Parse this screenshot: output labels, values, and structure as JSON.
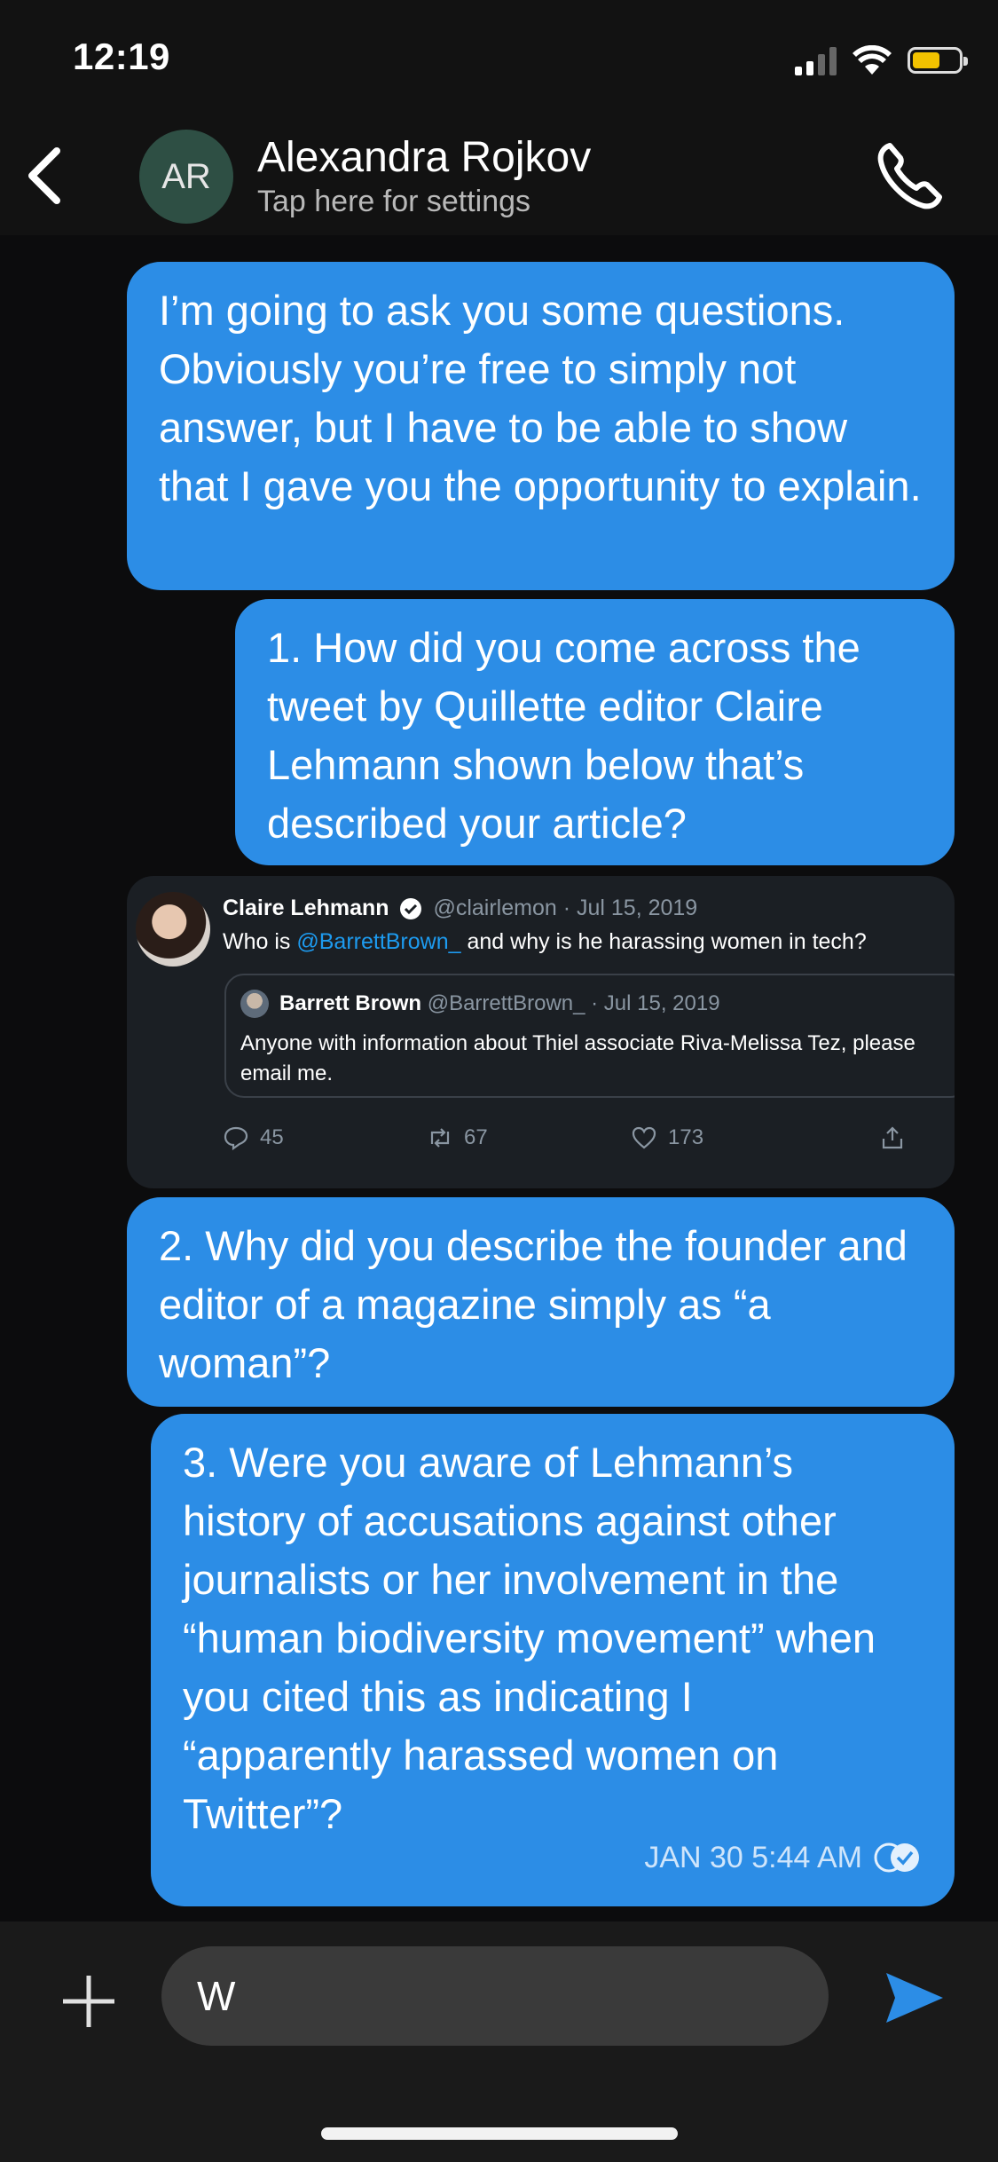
{
  "status_bar": {
    "time": "12:19",
    "battery_color": "#f2c200"
  },
  "header": {
    "avatar_initials": "AR",
    "contact_name": "Alexandra Rojkov",
    "subtitle": "Tap here for settings",
    "avatar_color": "#2e4f44"
  },
  "messages": [
    {
      "text": "I’m going to ask you some questions. Obviously you’re free to simply not answer, but I have to be able to show that I gave you the opportunity to explain."
    },
    {
      "text": "1. How did you come across the tweet by Quillette editor Claire Lehmann shown below that’s described your article?"
    },
    {
      "tweet": {
        "name": "Claire Lehmann",
        "handle_date": "@clairlemon · Jul 15, 2019",
        "text_before": "Who is ",
        "mention": "@BarrettBrown_",
        "text_after": " and why is he harassing women in tech?",
        "quote": {
          "name": "Barrett Brown",
          "handle_date": "@BarrettBrown_ · Jul 15, 2019",
          "text": "Anyone with information about Thiel associate Riva-Melissa Tez, please email me."
        },
        "replies": "45",
        "retweets": "67",
        "likes": "173"
      }
    },
    {
      "text": "2. Why did you describe the founder and editor of a magazine simply as “a woman”?"
    },
    {
      "text": "3. Were you aware of Lehmann’s history of accusations against other journalists or her involvement in the “human biodiversity movement” when you cited this as indicating I “apparently harassed women on Twitter”?",
      "timestamp": "JAN 30 5:44 AM"
    }
  ],
  "composer": {
    "input_value": "W"
  },
  "colors": {
    "bubble": "#2c8de6",
    "accent": "#2c8de6",
    "background": "#0c0c0d"
  },
  "icons": [
    "back-chevron-icon",
    "phone-icon",
    "verified-icon",
    "reply-icon",
    "retweet-icon",
    "like-icon",
    "share-icon",
    "read-receipt-icon",
    "plus-icon",
    "send-icon"
  ]
}
